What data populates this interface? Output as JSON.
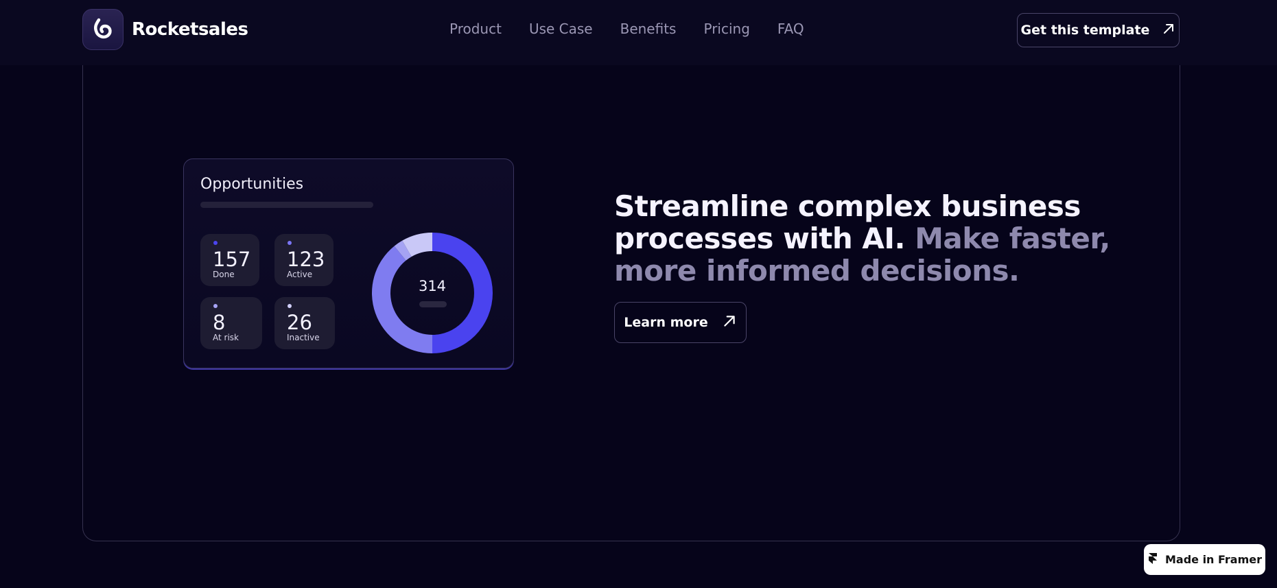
{
  "brand": {
    "name": "Rocketsales"
  },
  "nav": {
    "items": [
      "Product",
      "Use Case",
      "Benefits",
      "Pricing",
      "FAQ"
    ]
  },
  "header": {
    "cta_label": "Get this template",
    "cta_icon": "arrow-up-right-icon"
  },
  "card": {
    "title": "Opportunities",
    "stats": [
      {
        "value": "157",
        "label": "Done",
        "dot_color": "#4b45f0"
      },
      {
        "value": "123",
        "label": "Active",
        "dot_color": "#7a75f5"
      },
      {
        "value": "8",
        "label": "At risk",
        "dot_color": "#a7a4f7"
      },
      {
        "value": "26",
        "label": "Inactive",
        "dot_color": "#d2d0fb"
      }
    ],
    "donut_total": "314"
  },
  "chart_data": {
    "type": "pie",
    "categories": [
      "Done",
      "Active",
      "At risk",
      "Inactive"
    ],
    "values": [
      157,
      123,
      8,
      26
    ],
    "colors": [
      "#4a43ef",
      "#7f7cf0",
      "#a5a3f3",
      "#c9c8f7"
    ],
    "center_label": "314"
  },
  "hero": {
    "headline_strong": "Streamline complex business processes with AI.",
    "headline_muted": "Make faster, more informed decisions.",
    "cta_label": "Learn more",
    "cta_icon": "arrow-up-right-icon"
  },
  "badge": {
    "label": "Made in Framer",
    "icon": "framer-logo-icon"
  },
  "colors": {
    "background": "#06041a",
    "accent": "#4a43ef",
    "muted_text": "#8e89ad"
  }
}
